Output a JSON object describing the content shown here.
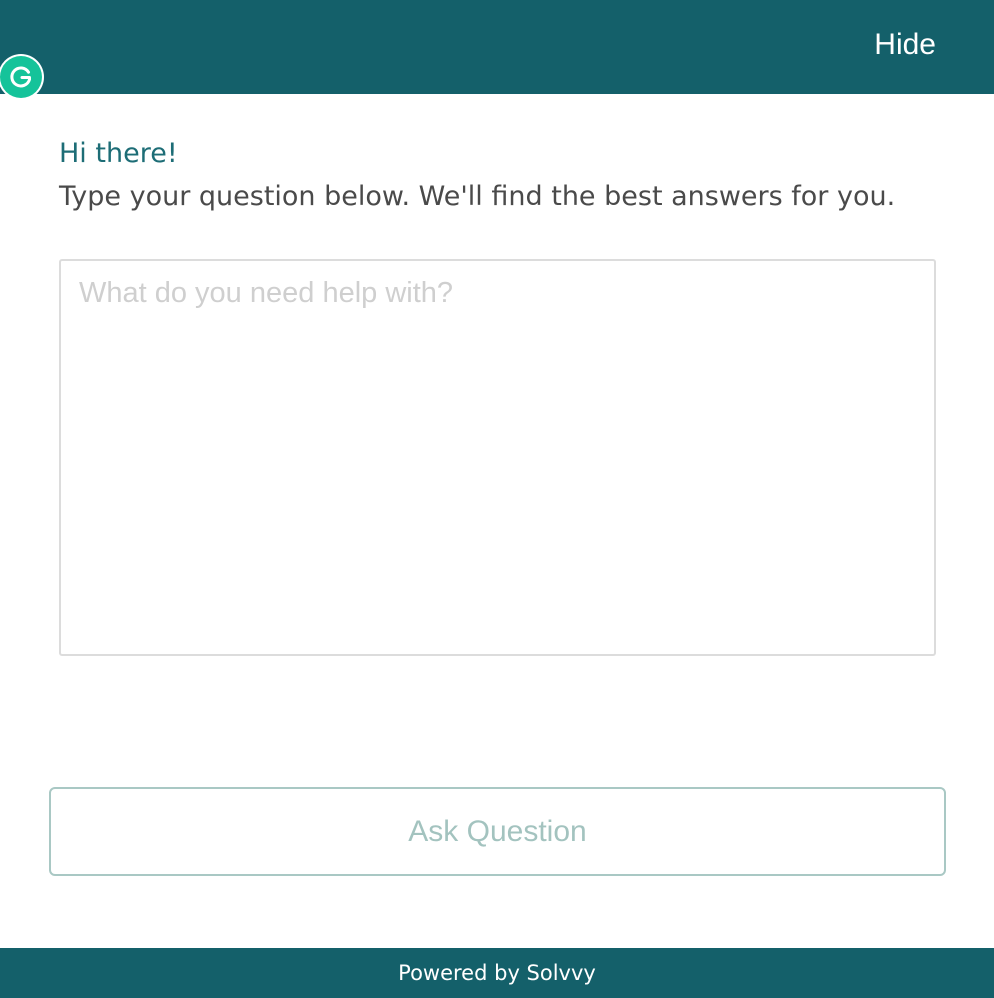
{
  "header": {
    "hide_label": "Hide",
    "background_color": "#14606a"
  },
  "extension_badge": {
    "icon": "grammarly-g-icon",
    "color": "#15c39a"
  },
  "intro": {
    "greeting": "Hi there!",
    "instructions": "Type your question below. We'll find the best answers for you."
  },
  "question_input": {
    "value": "",
    "placeholder": "What do you need help with?"
  },
  "ask_button": {
    "label": "Ask Question",
    "state": "disabled"
  },
  "footer": {
    "text": "Powered by Solvvy"
  }
}
